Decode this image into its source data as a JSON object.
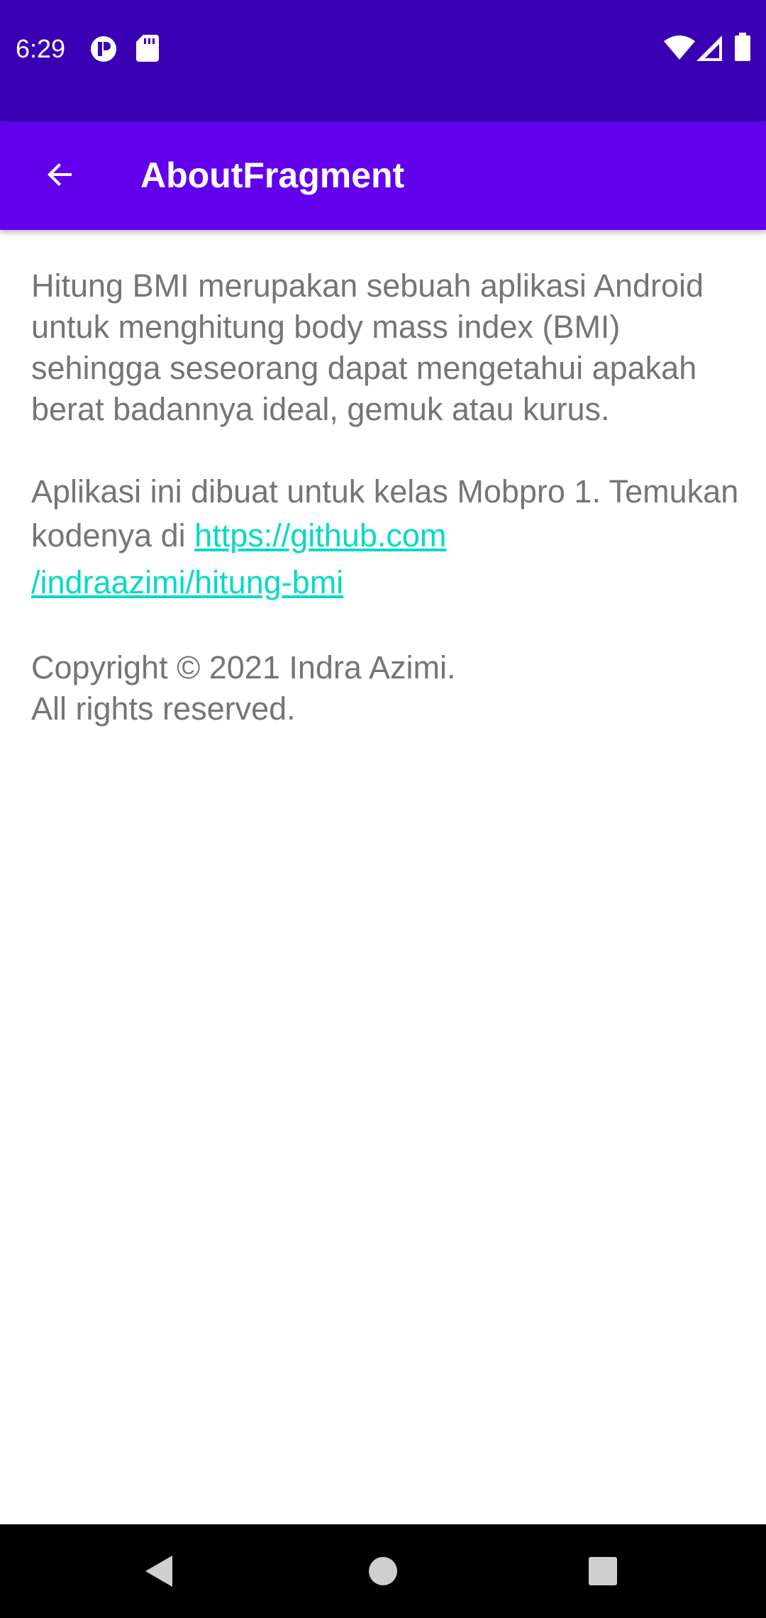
{
  "status_bar": {
    "time": "6:29",
    "background": "#3b00b3",
    "icons": [
      "notification-icon",
      "sd-card-icon",
      "wifi-icon",
      "cell-signal-icon",
      "battery-icon"
    ]
  },
  "app_bar": {
    "title": "AboutFragment",
    "background": "#6200ee",
    "back_icon": "arrow-back-icon"
  },
  "content": {
    "paragraph1": "Hitung BMI merupakan sebuah aplikasi Android untuk menghitung body mass index (BMI) sehingga seseorang dapat mengetahui apakah berat badannya ideal, gemuk atau kurus.",
    "paragraph2_prefix": "Aplikasi ini dibuat untuk kelas Mobpro 1. Temukan kodenya di ",
    "link_part1": "https://github.com",
    "link_part2": "/indraazimi/hitung-bmi",
    "copyright_line1": "Copyright © 2021 Indra Azimi.",
    "copyright_line2": "All rights reserved.",
    "text_color": "#757575",
    "link_color": "#03dac5"
  },
  "nav_bar": {
    "buttons": [
      "back-triangle-icon",
      "home-circle-icon",
      "recents-square-icon"
    ]
  }
}
